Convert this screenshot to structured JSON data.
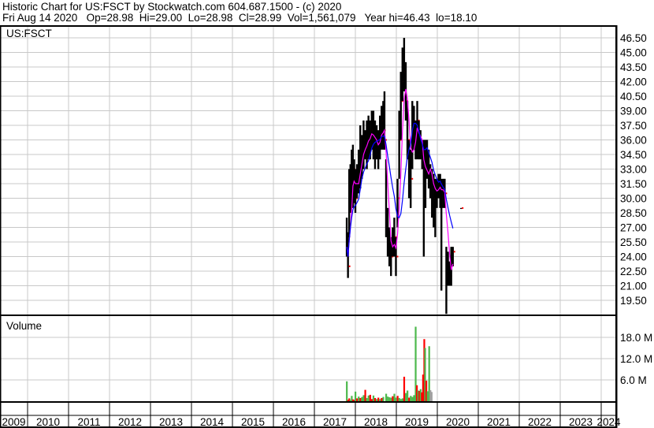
{
  "header": {
    "title": "Historic Chart for US:FSCT by Stockwatch.com 604.687.1500 - (c) 2020",
    "quote": "Fri Aug 14 2020   Op=28.98  Hi=29.00  Lo=28.98  Cl=28.99  Vol=1,561,079   Year hi=46.43  lo=18.10"
  },
  "chart_data": [
    {
      "type": "line",
      "title": "US:FSCT",
      "x_ticks": [
        "2009",
        "2010",
        "2011",
        "2012",
        "2013",
        "2014",
        "2015",
        "2016",
        "2017",
        "2018",
        "2019",
        "2020",
        "2021",
        "2022",
        "2023",
        "2024"
      ],
      "y_ticks": [
        "46.50",
        "45.00",
        "43.50",
        "42.00",
        "40.50",
        "39.00",
        "37.50",
        "36.00",
        "34.50",
        "33.00",
        "31.50",
        "30.00",
        "28.50",
        "27.00",
        "25.50",
        "24.00",
        "22.50",
        "21.00",
        "19.50"
      ],
      "ylim": [
        18.3,
        47.7
      ],
      "xlim": [
        2009.33,
        2024.37
      ],
      "grid": true,
      "series_format": "[year, low, high, close]",
      "ohlc": [
        [
          2017.79,
          24,
          28,
          25
        ],
        [
          2017.82,
          21.8,
          26.5,
          23
        ],
        [
          2017.85,
          26,
          33,
          29
        ],
        [
          2017.88,
          28.5,
          33.5,
          31
        ],
        [
          2017.91,
          29,
          35,
          32
        ],
        [
          2017.94,
          29,
          35.5,
          33
        ],
        [
          2017.97,
          29.5,
          34,
          31
        ],
        [
          2018.0,
          28.5,
          33,
          30
        ],
        [
          2018.04,
          30,
          33.5,
          32
        ],
        [
          2018.08,
          30.5,
          35,
          33
        ],
        [
          2018.12,
          31,
          37.5,
          35
        ],
        [
          2018.16,
          32,
          36.5,
          34
        ],
        [
          2018.2,
          33,
          38,
          36
        ],
        [
          2018.24,
          34,
          37,
          35
        ],
        [
          2018.28,
          33,
          38,
          36.5
        ],
        [
          2018.32,
          34,
          38.5,
          36
        ],
        [
          2018.36,
          34,
          38,
          37
        ],
        [
          2018.4,
          35,
          39,
          37
        ],
        [
          2018.44,
          34,
          39,
          36
        ],
        [
          2018.48,
          33,
          38,
          35
        ],
        [
          2018.52,
          34,
          37.5,
          36
        ],
        [
          2018.56,
          33,
          37,
          35
        ],
        [
          2018.6,
          34,
          38.5,
          37
        ],
        [
          2018.64,
          35,
          39.5,
          38
        ],
        [
          2018.68,
          35,
          40,
          37
        ],
        [
          2018.71,
          35,
          41,
          36
        ],
        [
          2018.75,
          26,
          34,
          28
        ],
        [
          2018.79,
          24,
          29,
          25
        ],
        [
          2018.83,
          23,
          27,
          25.5
        ],
        [
          2018.87,
          22,
          26,
          24
        ],
        [
          2018.91,
          24,
          27,
          25.5
        ],
        [
          2018.95,
          24,
          28,
          26
        ],
        [
          2018.99,
          22,
          26,
          24
        ],
        [
          2019.03,
          27,
          32,
          30
        ],
        [
          2019.07,
          32,
          39,
          36
        ],
        [
          2019.11,
          36,
          43,
          40
        ],
        [
          2019.15,
          40,
          45.5,
          42
        ],
        [
          2019.19,
          41,
          46.5,
          43
        ],
        [
          2019.23,
          38,
          44,
          40
        ],
        [
          2019.27,
          34,
          40,
          36
        ],
        [
          2019.31,
          30,
          36,
          33
        ],
        [
          2019.35,
          29,
          35,
          32
        ],
        [
          2019.39,
          33,
          40,
          38
        ],
        [
          2019.43,
          35,
          39.5,
          37
        ],
        [
          2019.47,
          34,
          38,
          36
        ],
        [
          2019.51,
          34,
          40,
          38
        ],
        [
          2019.55,
          34,
          38,
          36
        ],
        [
          2019.59,
          34,
          37,
          35.5
        ],
        [
          2019.63,
          33,
          36,
          34.5
        ],
        [
          2019.67,
          24,
          36,
          30
        ],
        [
          2019.71,
          29,
          36,
          33
        ],
        [
          2019.75,
          32,
          36,
          34
        ],
        [
          2019.79,
          31,
          35,
          33
        ],
        [
          2019.83,
          30,
          33.5,
          32
        ],
        [
          2019.87,
          28,
          33,
          31
        ],
        [
          2019.91,
          27,
          32.5,
          30
        ],
        [
          2019.95,
          26,
          32,
          31
        ],
        [
          2019.99,
          29,
          32,
          31
        ],
        [
          2020.03,
          30,
          32.5,
          31.5
        ],
        [
          2020.07,
          29,
          32.5,
          31
        ],
        [
          2020.1,
          20.5,
          32,
          30
        ],
        [
          2020.14,
          29,
          32,
          31
        ],
        [
          2020.18,
          29,
          32,
          30.5
        ],
        [
          2020.22,
          18.1,
          25,
          22
        ],
        [
          2020.26,
          21,
          24.5,
          22.5
        ],
        [
          2020.3,
          21,
          23.5,
          22
        ],
        [
          2020.34,
          21,
          25,
          24
        ],
        [
          2020.38,
          23,
          25,
          24.5
        ],
        [
          2020.58,
          28.9,
          29,
          28.99
        ]
      ],
      "moving_averages": [
        {
          "name": "short MA",
          "color": "#ff00ff",
          "period": 4
        },
        {
          "name": "long MA",
          "color": "#0000ff",
          "period": 10
        }
      ]
    },
    {
      "type": "bar",
      "title": "Volume",
      "y_ticks": [
        "18.0 M",
        "12.0 M",
        "6.0 M"
      ],
      "ylim": [
        0,
        24
      ],
      "unit": "M",
      "colors": {
        "up": "#4db84d",
        "down": "#ff0000",
        "flat": "#a0a0a0"
      },
      "bars": [
        [
          2017.79,
          5.6,
          "up"
        ],
        [
          2017.82,
          0.4,
          "down"
        ],
        [
          2017.85,
          0.8,
          "down"
        ],
        [
          2017.88,
          0.4,
          "up"
        ],
        [
          2017.91,
          1.5,
          "up"
        ],
        [
          2017.94,
          0.5,
          "down"
        ],
        [
          2017.97,
          0.4,
          "down"
        ],
        [
          2018.0,
          2.7,
          "up"
        ],
        [
          2018.04,
          0.8,
          "down"
        ],
        [
          2018.08,
          1.3,
          "up"
        ],
        [
          2018.12,
          0.9,
          "down"
        ],
        [
          2018.16,
          1.2,
          "up"
        ],
        [
          2018.2,
          1.7,
          "up"
        ],
        [
          2018.24,
          3.2,
          "down"
        ],
        [
          2018.28,
          0.9,
          "up"
        ],
        [
          2018.32,
          1.6,
          "up"
        ],
        [
          2018.36,
          1.8,
          "down"
        ],
        [
          2018.4,
          0.6,
          "down"
        ],
        [
          2018.44,
          1.6,
          "up"
        ],
        [
          2018.48,
          0.9,
          "down"
        ],
        [
          2018.52,
          0.6,
          "up"
        ],
        [
          2018.56,
          1.0,
          "down"
        ],
        [
          2018.6,
          0.6,
          "up"
        ],
        [
          2018.64,
          0.9,
          "down"
        ],
        [
          2018.68,
          1.2,
          "up"
        ],
        [
          2018.75,
          2.1,
          "up"
        ],
        [
          2018.79,
          1.3,
          "up"
        ],
        [
          2018.83,
          1.1,
          "up"
        ],
        [
          2018.87,
          1.0,
          "up"
        ],
        [
          2018.91,
          1.4,
          "down"
        ],
        [
          2018.95,
          2.1,
          "up"
        ],
        [
          2018.99,
          1.0,
          "up"
        ],
        [
          2019.03,
          1.5,
          "down"
        ],
        [
          2019.07,
          0.9,
          "up"
        ],
        [
          2019.11,
          0.6,
          "up"
        ],
        [
          2019.15,
          0.8,
          "up"
        ],
        [
          2019.19,
          6.9,
          "down"
        ],
        [
          2019.23,
          2.3,
          "up"
        ],
        [
          2019.27,
          3.0,
          "up"
        ],
        [
          2019.31,
          1.0,
          "down"
        ],
        [
          2019.35,
          1.5,
          "up"
        ],
        [
          2019.39,
          1.2,
          "up"
        ],
        [
          2019.43,
          1.7,
          "up"
        ],
        [
          2019.47,
          21.0,
          "up"
        ],
        [
          2019.5,
          4.5,
          "down"
        ],
        [
          2019.53,
          3.0,
          "up"
        ],
        [
          2019.56,
          2.9,
          "down"
        ],
        [
          2019.59,
          3.4,
          "up"
        ],
        [
          2019.62,
          2.5,
          "down"
        ],
        [
          2019.65,
          7.5,
          "down"
        ],
        [
          2019.68,
          17.5,
          "down"
        ],
        [
          2019.7,
          15.0,
          "up"
        ],
        [
          2019.73,
          5.8,
          "down"
        ],
        [
          2019.76,
          2.8,
          "up"
        ],
        [
          2019.8,
          15.5,
          "up"
        ],
        [
          2019.83,
          3.1,
          "flat"
        ],
        [
          2019.86,
          2.6,
          "flat"
        ]
      ]
    }
  ]
}
